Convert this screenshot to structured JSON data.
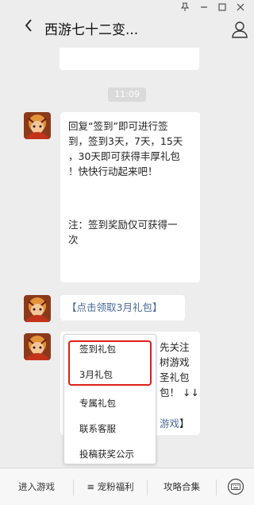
{
  "window": {
    "pin_icon": "pin-icon",
    "minimize_icon": "minimize-icon",
    "maximize_icon": "maximize-icon",
    "close_icon": "close-icon"
  },
  "header": {
    "back_icon": "chevron-left-icon",
    "title": "西游七十二变...",
    "profile_icon": "person-icon"
  },
  "chat": {
    "timestamp": "11:09",
    "message1_lines": [
      "回复“签到”即可进行签",
      "到，签到3天，7天，15天",
      "，30天即可获得丰厚礼包",
      "！快快行动起来吧！",
      "",
      "",
      "注：签到奖励仅可获得一",
      "次"
    ],
    "message2": "【点击领取3月礼包】",
    "message3_fragments": {
      "f1": "先关注",
      "f2": "树游戏",
      "f3": "圣礼包",
      "f4": "包！ ↓↓",
      "f5": "游戏",
      "f6": "】"
    }
  },
  "popup_menu": {
    "items": [
      "签到礼包",
      "3月礼包",
      "专属礼包",
      "联系客服",
      "投稿获奖公示"
    ]
  },
  "bottom_bar": {
    "tab1": "进入游戏",
    "tab2": "≡ 宠粉福利",
    "tab3": "攻略合集",
    "keyboard_icon": "keyboard-icon"
  },
  "colors": {
    "background": "#ededed",
    "bubble": "#ffffff",
    "link": "#4a6a98",
    "highlight": "#e0201a"
  }
}
